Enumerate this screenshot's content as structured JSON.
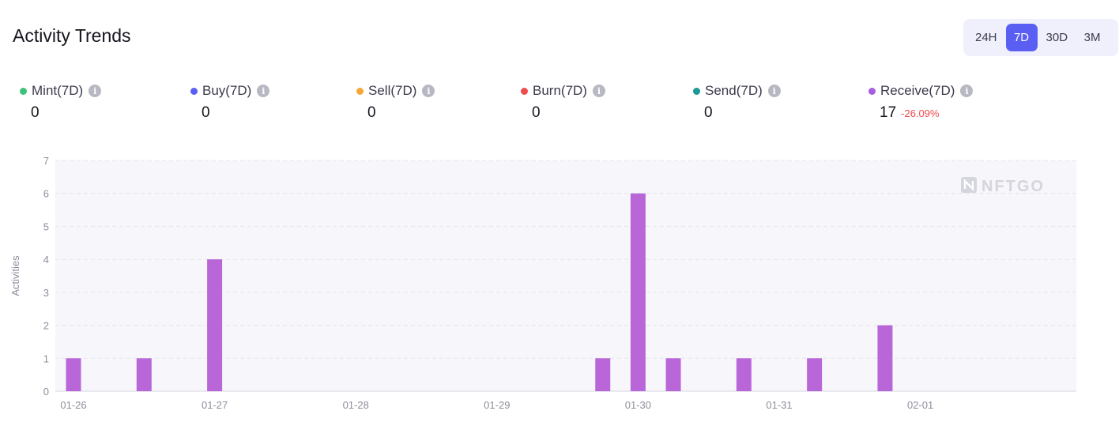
{
  "header": {
    "title": "Activity Trends"
  },
  "range_options": [
    {
      "label": "24H",
      "active": false
    },
    {
      "label": "7D",
      "active": true
    },
    {
      "label": "30D",
      "active": false
    },
    {
      "label": "3M",
      "active": false
    }
  ],
  "metrics": [
    {
      "label": "Mint(7D)",
      "value": "0",
      "color": "#3cc27d"
    },
    {
      "label": "Buy(7D)",
      "value": "0",
      "color": "#5a5ef2"
    },
    {
      "label": "Sell(7D)",
      "value": "0",
      "color": "#f7a838"
    },
    {
      "label": "Burn(7D)",
      "value": "0",
      "color": "#ef4b4b"
    },
    {
      "label": "Send(7D)",
      "value": "0",
      "color": "#1a9a94"
    },
    {
      "label": "Receive(7D)",
      "value": "17",
      "change": "-26.09%",
      "color": "#a85ce0"
    }
  ],
  "watermark": "NFTGO",
  "chart_data": {
    "type": "bar",
    "ylabel": "Activities",
    "ylim": [
      0,
      7
    ],
    "yticks": [
      "0",
      "1",
      "2",
      "3",
      "4",
      "5",
      "6",
      "7"
    ],
    "xticks": [
      "01-26",
      "01-27",
      "01-28",
      "01-29",
      "01-30",
      "01-31",
      "02-01"
    ],
    "bar_color": "#b966d8",
    "bars": [
      {
        "x": "01-26 00:00",
        "value": 1
      },
      {
        "x": "01-26 12:00",
        "value": 1
      },
      {
        "x": "01-27 00:00",
        "value": 4
      },
      {
        "x": "01-29 18:00",
        "value": 1
      },
      {
        "x": "01-30 00:00",
        "value": 6
      },
      {
        "x": "01-30 06:00",
        "value": 1
      },
      {
        "x": "01-30 18:00",
        "value": 1
      },
      {
        "x": "01-31 06:00",
        "value": 1
      },
      {
        "x": "01-31 18:00",
        "value": 2
      }
    ]
  }
}
